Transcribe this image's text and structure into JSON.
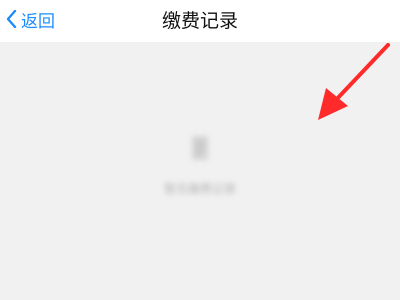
{
  "nav": {
    "back_label": "返回",
    "title": "缴费记录"
  },
  "empty_state": {
    "icon": "document-icon",
    "message": "暂无缴费记录"
  },
  "colors": {
    "accent": "#1a8cff",
    "content_bg": "#f1f1f1",
    "annotation": "#ff2a2a"
  }
}
